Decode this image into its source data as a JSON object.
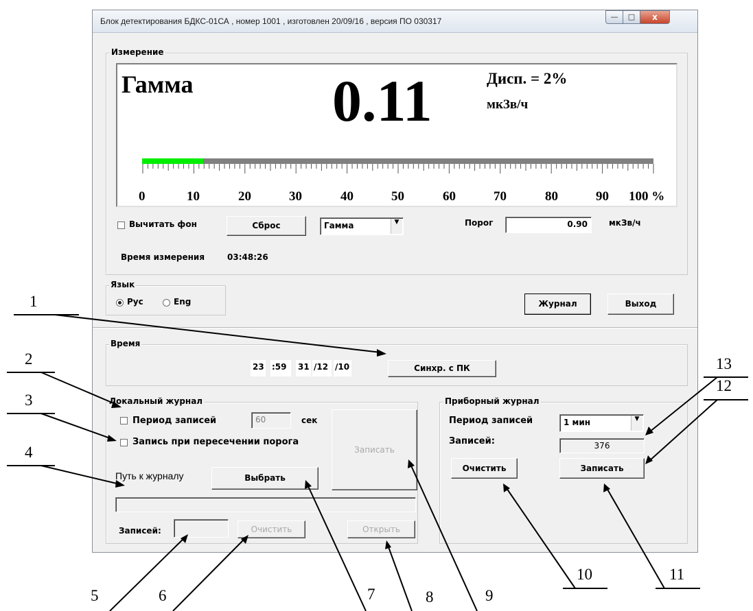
{
  "window": {
    "title": "Блок детектирования БДКС-01СА , номер 1001 , изготовлен 20/09/16 , версия ПО 030317",
    "minimize_icon": "minimize-icon",
    "maximize_icon": "maximize-icon",
    "close_icon": "close-icon",
    "close_glyph": "x"
  },
  "measurement": {
    "legend": "Измерение",
    "mode_title": "Гамма",
    "value": "0.11",
    "dispersion": "Дисп. = 2%",
    "unit": "мкЗв/ч",
    "scale_labels": [
      "0",
      "10",
      "20",
      "30",
      "40",
      "50",
      "60",
      "70",
      "80",
      "90",
      "100 %"
    ],
    "bar_level_percent": 12,
    "bar_fill_color": "#00ee00",
    "bar_track_color": "#808080",
    "subtract_bg_label": "Вычитать фон",
    "subtract_bg_checked": false,
    "reset_label": "Сброс",
    "mode_select_value": "Гамма",
    "threshold_label": "Порог",
    "threshold_value": "0.90",
    "threshold_unit": "мкЗв/ч",
    "time_label": "Время измерения",
    "time_value": "03:48:26"
  },
  "language": {
    "legend": "Язык",
    "rus_label": "Рус",
    "eng_label": "Eng",
    "selected": "Рус"
  },
  "actions": {
    "journal_label": "Журнал",
    "exit_label": "Выход"
  },
  "time_group": {
    "legend": "Время",
    "hours": "23",
    "minutes": ":59",
    "day": "31",
    "month": "/12",
    "year": "/10",
    "sync_label": "Синхр. с ПК"
  },
  "local_journal": {
    "legend": "Локальный журнал",
    "period_label": "Период записей",
    "period_checked": false,
    "period_value": "60",
    "period_unit": "сек",
    "threshold_record_label": "Запись при пересечении порога",
    "threshold_record_checked": false,
    "write_label": "Записать",
    "path_label": "Путь к журналу",
    "choose_label": "Выбрать",
    "path_value": "",
    "records_label": "Записей:",
    "records_value": "",
    "clear_label": "Очистить",
    "open_label": "Открыть"
  },
  "device_journal": {
    "legend": "Приборный журнал",
    "period_label": "Период записей",
    "period_select_value": "1 мин",
    "records_label": "Записей:",
    "records_value": "376",
    "clear_label": "Очистить",
    "write_label": "Записать"
  },
  "callouts": [
    "1",
    "2",
    "3",
    "4",
    "5",
    "6",
    "7",
    "8",
    "9",
    "10",
    "11",
    "12",
    "13"
  ]
}
